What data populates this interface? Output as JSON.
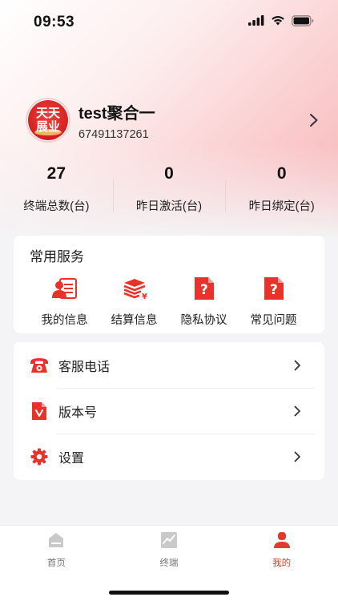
{
  "status_bar": {
    "time": "09:53",
    "icons": [
      "signal-icon",
      "wifi-icon",
      "battery-icon"
    ]
  },
  "profile": {
    "logo_text_line1": "天天",
    "logo_text_line2": "展业",
    "name": "test聚合一",
    "id": "67491137261"
  },
  "stats": [
    {
      "value": "27",
      "label": "终端总数(台)"
    },
    {
      "value": "0",
      "label": "昨日激活(台)"
    },
    {
      "value": "0",
      "label": "昨日绑定(台)"
    }
  ],
  "services": {
    "title": "常用服务",
    "items": [
      {
        "label": "我的信息",
        "icon": "id-card-icon"
      },
      {
        "label": "结算信息",
        "icon": "settlement-stack-icon"
      },
      {
        "label": "隐私协议",
        "icon": "privacy-doc-icon"
      },
      {
        "label": "常见问题",
        "icon": "faq-doc-icon"
      }
    ]
  },
  "menu": [
    {
      "label": "客服电话",
      "icon": "phone-icon"
    },
    {
      "label": "版本号",
      "icon": "version-doc-icon"
    },
    {
      "label": "设置",
      "icon": "gear-icon"
    }
  ],
  "tabbar": {
    "tabs": [
      {
        "label": "首页",
        "icon": "home-icon",
        "active": false
      },
      {
        "label": "终端",
        "icon": "chart-icon",
        "active": false
      },
      {
        "label": "我的",
        "icon": "person-icon",
        "active": true
      }
    ]
  },
  "colors": {
    "accent": "#e23a2c",
    "icon_red": "#e8322a",
    "inactive": "#999999"
  }
}
